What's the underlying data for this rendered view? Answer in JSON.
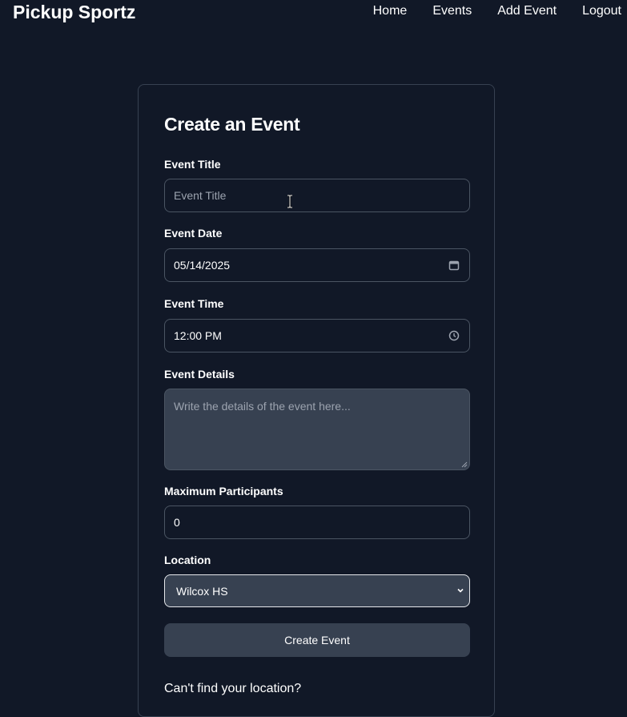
{
  "nav": {
    "brand": "Pickup Sportz",
    "links": [
      {
        "label": "Home"
      },
      {
        "label": "Events"
      },
      {
        "label": "Add Event"
      },
      {
        "label": "Logout"
      }
    ]
  },
  "form": {
    "title": "Create an Event",
    "event_title": {
      "label": "Event Title",
      "placeholder": "Event Title",
      "value": ""
    },
    "event_date": {
      "label": "Event Date",
      "value": "05/14/2025",
      "icon": "calendar-icon"
    },
    "event_time": {
      "label": "Event Time",
      "value": "12:00 PM",
      "icon": "clock-icon"
    },
    "event_details": {
      "label": "Event Details",
      "placeholder": "Write the details of the event here..."
    },
    "max_participants": {
      "label": "Maximum Participants",
      "value": "0"
    },
    "location": {
      "label": "Location",
      "selected": "Wilcox HS",
      "icon": "chevron-down-icon"
    },
    "submit_label": "Create Event",
    "cant_find_location": "Can't find your location?"
  },
  "colors": {
    "background": "#111827",
    "field_bg": "#374151",
    "border": "#4b5563",
    "placeholder": "#9ca3af",
    "text": "#ffffff"
  }
}
